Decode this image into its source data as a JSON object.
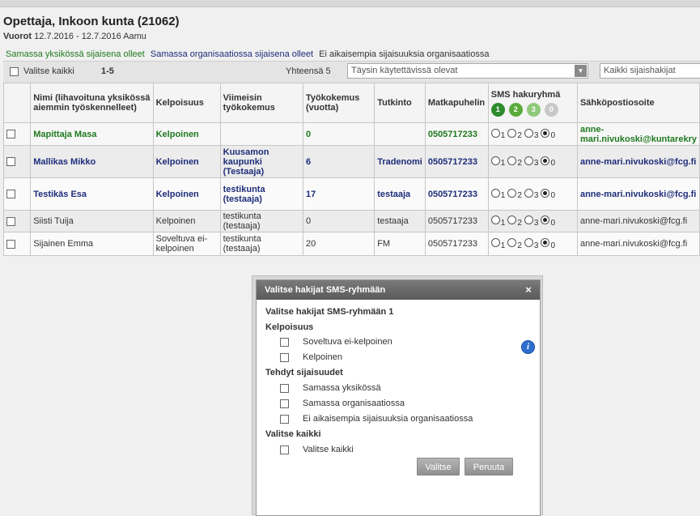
{
  "header": {
    "title": "Opettaja, Inkoon kunta (21062)",
    "shifts_label": "Vuorot",
    "shifts_value": "12.7.2016 - 12.7.2016 Aamu"
  },
  "filters": [
    "Samassa yksikössä sijaisena olleet",
    "Samassa organisaatiossa sijaisena olleet",
    "Ei aikaisempia sijaisuuksia organisaatiossa"
  ],
  "toolbar": {
    "select_all": "Valitse kaikki",
    "range": "1-5",
    "total": "Yhteensä 5",
    "availability_select": "Täysin käytettävissä olevat",
    "applicants_input": "Kaikki sijaishakijat"
  },
  "columns": {
    "name": "Nimi (lihavoituna yksikössä aiemmin työskennelleet)",
    "eligibility": "Kelpoisuus",
    "latest_experience": "Viimeisin työkokemus",
    "experience_years": "Työkokemus (vuotta)",
    "degree": "Tutkinto",
    "mobile": "Matkapuhelin",
    "sms_group": "SMS hakuryhmä",
    "email": "Sähköpostiosoite"
  },
  "sms_groups": [
    {
      "num": "1",
      "color": "#2e8b2e"
    },
    {
      "num": "2",
      "color": "#5aab3c"
    },
    {
      "num": "3",
      "color": "#8fc97a"
    },
    {
      "num": "0",
      "color": "#c8c8c8"
    }
  ],
  "radio_labels": [
    "1",
    "2",
    "3",
    "0"
  ],
  "rows": [
    {
      "name": "Mapittaja Masa",
      "eligibility": "Kelpoinen",
      "latest": "",
      "years": "0",
      "degree": "",
      "mobile": "0505717233",
      "email": "anne-mari.nivukoski@kuntarekry"
    },
    {
      "name": "Mallikas Mikko",
      "eligibility": "Kelpoinen",
      "latest": "Kuusamon kaupunki (Testaaja)",
      "years": "6",
      "degree": "Tradenomi",
      "mobile": "0505717233",
      "email": "anne-mari.nivukoski@fcg.fi"
    },
    {
      "name": "Testikäs Esa",
      "eligibility": "Kelpoinen",
      "latest": "testikunta (testaaja)",
      "years": "17",
      "degree": "testaaja",
      "mobile": "0505717233",
      "email": "anne-mari.nivukoski@fcg.fi"
    },
    {
      "name": "Siisti Tuija",
      "eligibility": "Kelpoinen",
      "latest": "testikunta (testaaja)",
      "years": "0",
      "degree": "testaaja",
      "mobile": "0505717233",
      "email": "anne-mari.nivukoski@fcg.fi"
    },
    {
      "name": "Sijainen Emma",
      "eligibility": "Soveltuva ei-kelpoinen",
      "latest": "testikunta (testaaja)",
      "years": "20",
      "degree": "FM",
      "mobile": "0505717233",
      "email": "anne-mari.nivukoski@fcg.fi"
    }
  ],
  "dialog": {
    "title": "Valitse hakijat SMS-ryhmään",
    "close": "×",
    "subtitle": "Valitse hakijat SMS-ryhmään 1",
    "section_eligibility": "Kelpoisuus",
    "opt_suitable_not_eligible": "Soveltuva ei-kelpoinen",
    "opt_eligible": "Kelpoinen",
    "section_substitutions": "Tehdyt sijaisuudet",
    "opt_same_unit": "Samassa yksikössä",
    "opt_same_org": "Samassa organisaatiossa",
    "opt_none_before": "Ei aikaisempia sijaisuuksia organisaatiossa",
    "section_select_all": "Valitse kaikki",
    "opt_select_all": "Valitse kaikki",
    "ok_button": "Valitse",
    "cancel_button": "Peruuta"
  }
}
